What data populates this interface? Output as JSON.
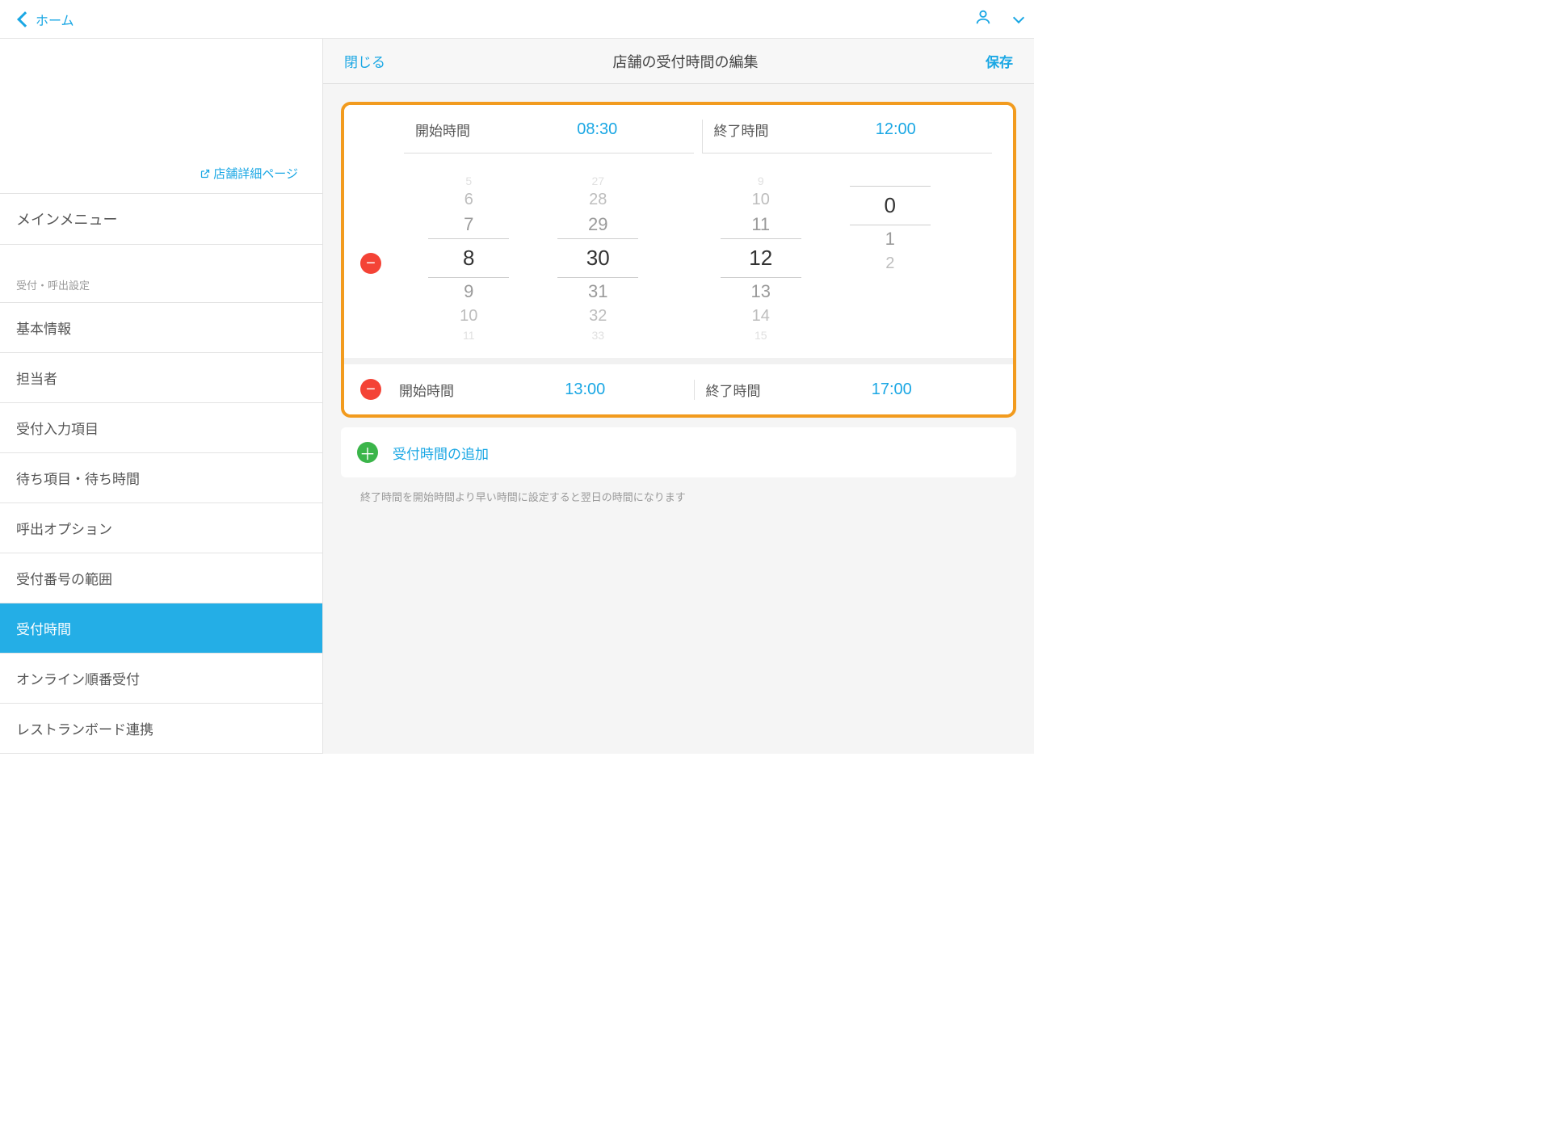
{
  "topnav": {
    "back": "ホーム"
  },
  "sidebar": {
    "store_link": "店舗詳細ページ",
    "main_menu": "メインメニュー",
    "section": "受付・呼出設定",
    "items": [
      {
        "label": "基本情報"
      },
      {
        "label": "担当者"
      },
      {
        "label": "受付入力項目"
      },
      {
        "label": "待ち項目・待ち時間"
      },
      {
        "label": "呼出オプション"
      },
      {
        "label": "受付番号の範囲"
      },
      {
        "label": "受付時間",
        "active": true
      },
      {
        "label": "オンライン順番受付"
      },
      {
        "label": "レストランボード連携"
      }
    ]
  },
  "main": {
    "close": "閉じる",
    "title": "店舗の受付時間の編集",
    "save": "保存",
    "slots": [
      {
        "start_label": "開始時間",
        "start_value": "08:30",
        "end_label": "終了時間",
        "end_value": "12:00",
        "picker": {
          "startH": {
            "far2": "5",
            "far": "6",
            "near": "7",
            "sel": "8",
            "nearD": "9",
            "farD": "10",
            "far2D": "11"
          },
          "startM": {
            "far2": "27",
            "far": "28",
            "near": "29",
            "sel": "30",
            "nearD": "31",
            "farD": "32",
            "far2D": "33"
          },
          "endH": {
            "far2": "9",
            "far": "10",
            "near": "11",
            "sel": "12",
            "nearD": "13",
            "farD": "14",
            "far2D": "15"
          },
          "endM": {
            "far2": "",
            "far": "",
            "near": "",
            "sel": "0",
            "nearD": "1",
            "farD": "2",
            "far2D": ""
          }
        }
      },
      {
        "start_label": "開始時間",
        "start_value": "13:00",
        "end_label": "終了時間",
        "end_value": "17:00"
      }
    ],
    "add": "受付時間の追加",
    "hint": "終了時間を開始時間より早い時間に設定すると翌日の時間になります"
  }
}
